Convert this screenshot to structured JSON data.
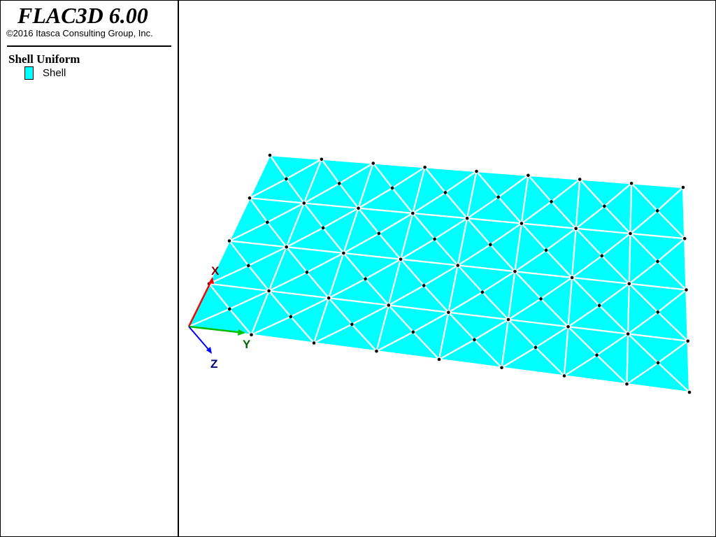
{
  "app": {
    "title": "FLAC3D 6.00",
    "copyright": "©2016 Itasca Consulting Group, Inc."
  },
  "legend": {
    "plot_title": "Shell Uniform",
    "items": [
      {
        "label": "Shell",
        "color": "#00ffff"
      }
    ]
  },
  "viewport": {
    "background": "#ffffff",
    "shell": {
      "fill_color": "#00ffff",
      "edge_color": "#ffffff",
      "node_color": "#000000",
      "grid_columns": 8,
      "grid_rows": 4
    },
    "axes": {
      "x": {
        "label": "X",
        "color": "#ff0000",
        "label_color": "#800000"
      },
      "y": {
        "label": "Y",
        "color": "#00c000",
        "label_color": "#006400"
      },
      "z": {
        "label": "Z",
        "color": "#0000ff",
        "label_color": "#000080"
      }
    }
  }
}
